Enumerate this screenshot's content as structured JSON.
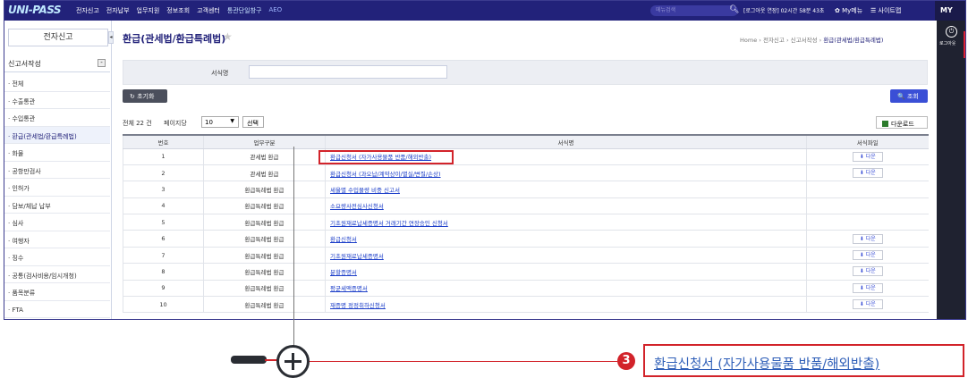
{
  "topbar": {
    "logo": "UNI-PASS",
    "menu": [
      "전자신고",
      "전자납부",
      "업무지원",
      "정보조회",
      "고객센터",
      "통관단일창구",
      "AEO"
    ],
    "search_placeholder": "메뉴검색",
    "session": "[로그아웃 연장] 02시간 58분 43초",
    "mymenu": "My메뉴",
    "sitemap": "사이트맵",
    "my_tab": "MY"
  },
  "rail": {
    "logout_label": "로그아웃"
  },
  "sidebar": {
    "title": "전자신고",
    "section": "신고서작성",
    "items": [
      {
        "label": "· 전체"
      },
      {
        "label": "· 수출통관"
      },
      {
        "label": "· 수입통관"
      },
      {
        "label": "· 환급(관세법/환급특례법)"
      },
      {
        "label": "· 화물"
      },
      {
        "label": "· 공항만검사"
      },
      {
        "label": "· 인허가"
      },
      {
        "label": "· 담보/체납 납부"
      },
      {
        "label": "· 심사"
      },
      {
        "label": "· 여행자"
      },
      {
        "label": "· 징수"
      },
      {
        "label": "· 공통(검사비용/임시개청)"
      },
      {
        "label": "· 품목분류"
      },
      {
        "label": "· FTA"
      }
    ]
  },
  "main": {
    "title": "환급(관세법/환급특례법)",
    "breadcrumb": {
      "home": "Home",
      "sep1": "›",
      "level1": "전자신고",
      "sep2": "›",
      "level2": "신고서작성",
      "sep3": "›",
      "current": "환급(관세법/환급특례법)"
    },
    "form_label": "서식명",
    "form_value": "",
    "reset_label": "↻ 초기화",
    "query_label": "🔍 조회",
    "total": "전체 22 건",
    "perpage_label": "페이지당",
    "perpage_value": "10",
    "select_label": "선택",
    "download_all": "다운로드",
    "columns": [
      "번호",
      "업무구분",
      "서식명",
      "서식파일"
    ],
    "rows": [
      {
        "no": "1",
        "type": "관세법 환급",
        "name": "환급신청서 (자가사용물품 반품/해외반출)",
        "file": "다운"
      },
      {
        "no": "2",
        "type": "관세법 환급",
        "name": "환급신청서 (과오납/계약상이/멸실/변질/손상)",
        "file": "다운"
      },
      {
        "no": "3",
        "type": "환급특례법 환급",
        "name": "세율별 수입물량 비중 신고서",
        "file": ""
      },
      {
        "no": "4",
        "type": "환급특례법 환급",
        "name": "소요량사전심사신청서",
        "file": ""
      },
      {
        "no": "5",
        "type": "환급특례법 환급",
        "name": "기초원재료납세증명서 거래기간 연장승인 신청서",
        "file": ""
      },
      {
        "no": "6",
        "type": "환급특례법 환급",
        "name": "환급신청서",
        "file": "다운"
      },
      {
        "no": "7",
        "type": "환급특례법 환급",
        "name": "기초원재료납세증명서",
        "file": "다운"
      },
      {
        "no": "8",
        "type": "환급특례법 환급",
        "name": "분할증명서",
        "file": "다운"
      },
      {
        "no": "9",
        "type": "환급특례법 환급",
        "name": "평균세액증명서",
        "file": "다운"
      },
      {
        "no": "10",
        "type": "환급특례법 환급",
        "name": "재증명 정정취하신청서",
        "file": "다운"
      }
    ],
    "download_btn_prefix": "⬇"
  },
  "callout": {
    "step": "3",
    "text": "환급신청서 (자가사용물품 반품/해외반출)"
  },
  "colors": {
    "navy": "#22227a",
    "highlight_red": "#d2232a",
    "link_blue": "#1a3cc8",
    "query_blue": "#3a4fd6"
  },
  "icons": [
    "search-icon",
    "star-icon",
    "logout-icon",
    "reset-icon",
    "excel-icon",
    "download-icon",
    "zoom-plus-icon"
  ]
}
